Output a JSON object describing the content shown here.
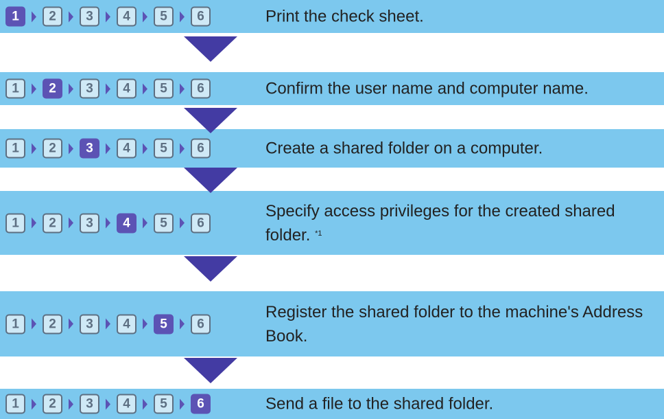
{
  "flow_title": "",
  "steps": [
    {
      "numbers": [
        "1",
        "2",
        "3",
        "4",
        "5",
        "6"
      ],
      "active": 1,
      "text": "Print the check sheet.",
      "note": ""
    },
    {
      "numbers": [
        "1",
        "2",
        "3",
        "4",
        "5",
        "6"
      ],
      "active": 2,
      "text": "Confirm the user name and computer name.",
      "note": ""
    },
    {
      "numbers": [
        "1",
        "2",
        "3",
        "4",
        "5",
        "6"
      ],
      "active": 3,
      "text": "Create a shared folder on a computer.",
      "note": ""
    },
    {
      "numbers": [
        "1",
        "2",
        "3",
        "4",
        "5",
        "6"
      ],
      "active": 4,
      "text": "Specify access privileges for the created shared folder.",
      "note": "*1"
    },
    {
      "numbers": [
        "1",
        "2",
        "3",
        "4",
        "5",
        "6"
      ],
      "active": 5,
      "text": "Register the shared folder to the machine's Address Book.",
      "note": ""
    },
    {
      "numbers": [
        "1",
        "2",
        "3",
        "4",
        "5",
        "6"
      ],
      "active": 6,
      "text": "Send a file to the shared folder.",
      "note": ""
    }
  ],
  "colors": {
    "bar_background": "#7cc8ee",
    "active_badge": "#5c53b4",
    "inactive_badge_border": "#5d6f82",
    "arrow": "#433ba3"
  },
  "icons": {
    "separator": "chevron-right-icon",
    "connector": "down-arrow-icon"
  }
}
